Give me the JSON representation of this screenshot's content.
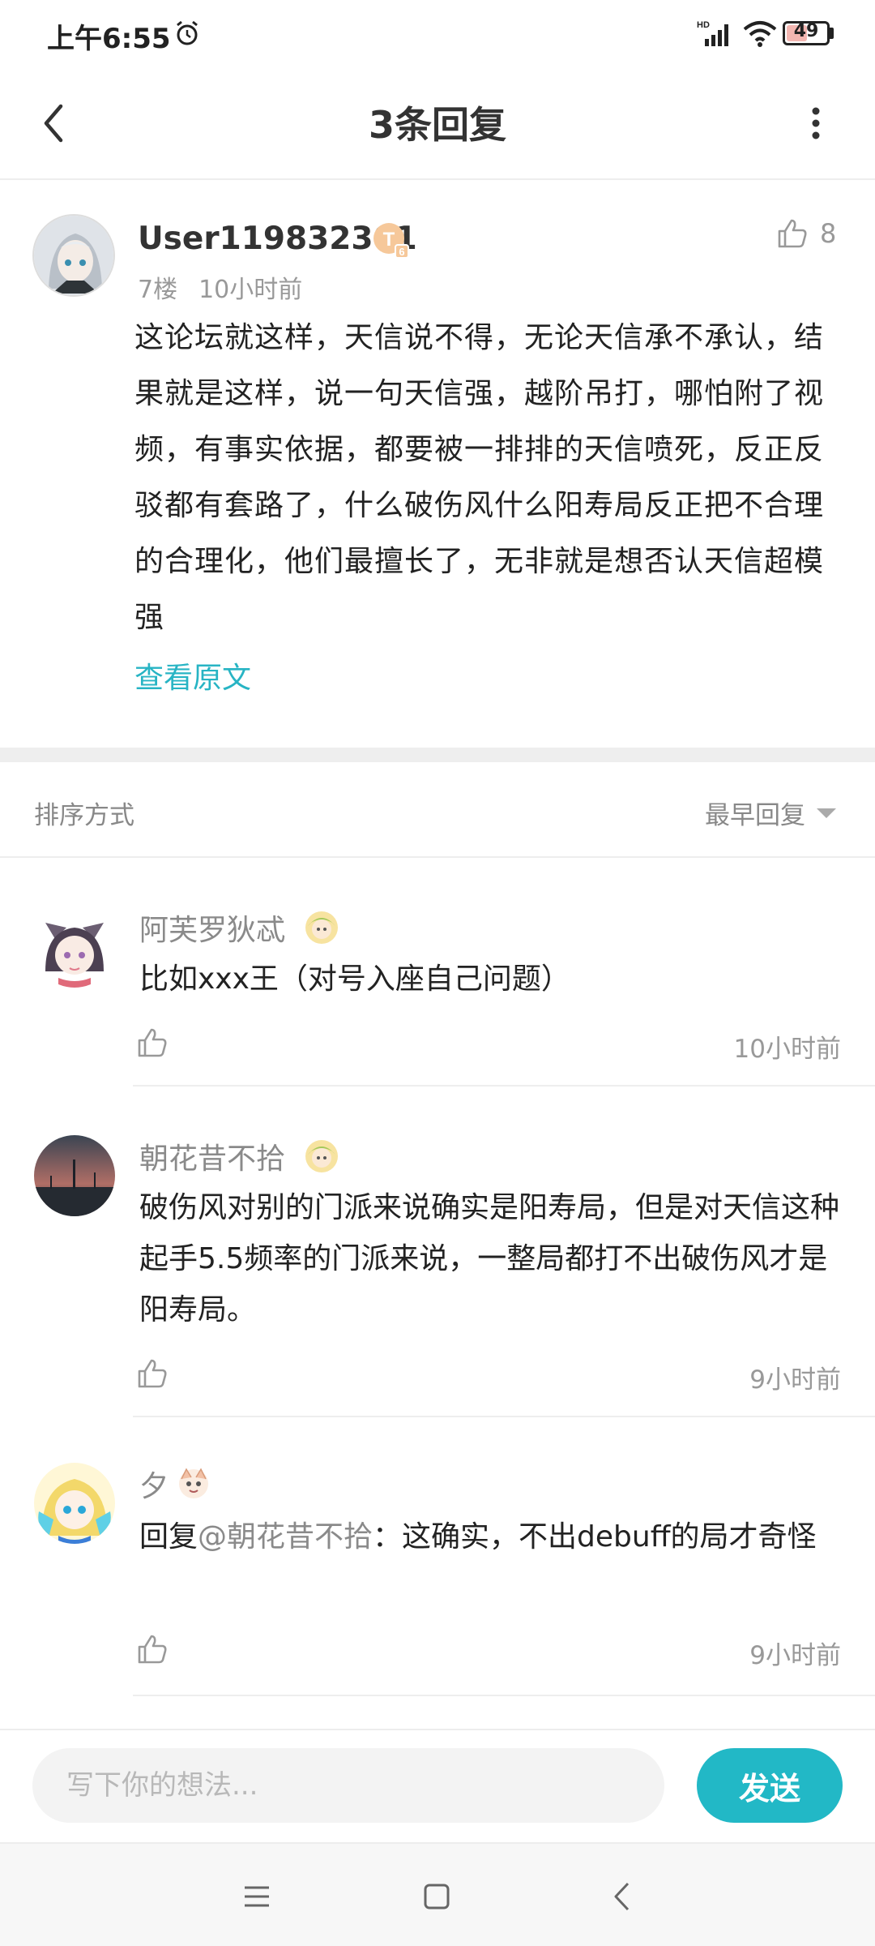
{
  "status_bar": {
    "time": "上午6:55",
    "battery": "49",
    "icons": [
      "alarm-icon",
      "signal-icon",
      "wifi-icon",
      "battery-icon"
    ]
  },
  "header": {
    "title": "3条回复",
    "icons": [
      "back-icon",
      "more-icon"
    ]
  },
  "post": {
    "username": "User119832301",
    "badge_letter": "T",
    "badge_sub": "6",
    "floor": "7楼",
    "time": "10小时前",
    "like_count": "8",
    "body": "这论坛就这样，天信说不得，无论天信承不承认，结果就是这样，说一句天信强，越阶吊打，哪怕附了视频，有事实依据，都要被一排排的天信喷死，反正反驳都有套路了，什么破伤风什么阳寿局反正把不合理的合理化，他们最擅长了，无非就是想否认天信超模强",
    "view_original": "查看原文"
  },
  "sort": {
    "label": "排序方式",
    "selected": "最早回复"
  },
  "replies": [
    {
      "name": "阿芙罗狄忒",
      "text": "比如xxx王（对号入座自己问题）",
      "time": "10小时前"
    },
    {
      "name": "朝花昔不拾",
      "text": "破伤风对别的门派来说确实是阳寿局，但是对天信这种起手5.5频率的门派来说，一整局都打不出破伤风才是阳寿局。",
      "time": "9小时前"
    },
    {
      "name": "夕",
      "reply_prefix": "回复",
      "mention": "@朝花昔不拾",
      "text": "：这确实，不出debuff的局才奇怪",
      "time": "9小时前"
    }
  ],
  "composer": {
    "placeholder": "写下你的想法...",
    "send_label": "发送"
  },
  "colors": {
    "accent": "#22b8c6",
    "link": "#27b4c4"
  }
}
